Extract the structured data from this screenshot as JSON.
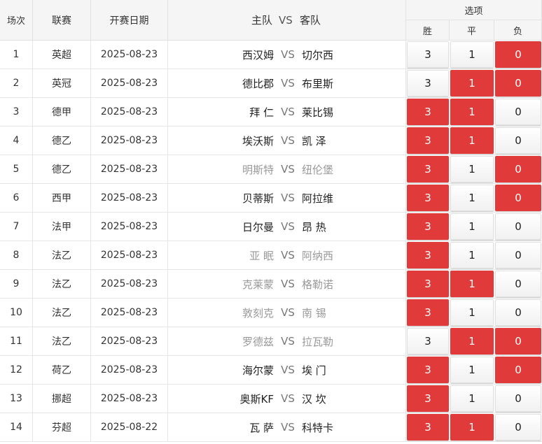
{
  "header": {
    "col_no": "场次",
    "col_league": "联赛",
    "col_date": "开赛日期",
    "home_label": "主队",
    "vs_label": "VS",
    "away_label": "客队",
    "options_label": "选项",
    "opt_win": "胜",
    "opt_draw": "平",
    "opt_loss": "负"
  },
  "colors": {
    "selected": "#e03a3a",
    "grid": "#e6e6e6",
    "header_bg": "#f5f5f5"
  },
  "rows": [
    {
      "no": "1",
      "league": "英超",
      "date": "2025-08-23",
      "home": "西汉姆",
      "vs": "VS",
      "away": "切尔西",
      "home_muted": false,
      "away_muted": false,
      "win": "3",
      "draw": "1",
      "loss": "0",
      "sel": [
        false,
        false,
        true
      ]
    },
    {
      "no": "2",
      "league": "英冠",
      "date": "2025-08-23",
      "home": "德比郡",
      "vs": "VS",
      "away": "布里斯",
      "home_muted": false,
      "away_muted": false,
      "win": "3",
      "draw": "1",
      "loss": "0",
      "sel": [
        false,
        true,
        true
      ]
    },
    {
      "no": "3",
      "league": "德甲",
      "date": "2025-08-23",
      "home": "拜 仁",
      "vs": "VS",
      "away": "莱比锡",
      "home_muted": false,
      "away_muted": false,
      "win": "3",
      "draw": "1",
      "loss": "0",
      "sel": [
        true,
        true,
        false
      ]
    },
    {
      "no": "4",
      "league": "德乙",
      "date": "2025-08-23",
      "home": "埃沃斯",
      "vs": "VS",
      "away": "凯 泽",
      "home_muted": false,
      "away_muted": false,
      "win": "3",
      "draw": "1",
      "loss": "0",
      "sel": [
        true,
        true,
        false
      ]
    },
    {
      "no": "5",
      "league": "德乙",
      "date": "2025-08-23",
      "home": "明斯特",
      "vs": "VS",
      "away": "纽伦堡",
      "home_muted": true,
      "away_muted": true,
      "win": "3",
      "draw": "1",
      "loss": "0",
      "sel": [
        true,
        false,
        true
      ]
    },
    {
      "no": "6",
      "league": "西甲",
      "date": "2025-08-23",
      "home": "贝蒂斯",
      "vs": "VS",
      "away": "阿拉维",
      "home_muted": false,
      "away_muted": false,
      "win": "3",
      "draw": "1",
      "loss": "0",
      "sel": [
        true,
        false,
        true
      ]
    },
    {
      "no": "7",
      "league": "法甲",
      "date": "2025-08-23",
      "home": "日尔曼",
      "vs": "VS",
      "away": "昂 热",
      "home_muted": false,
      "away_muted": false,
      "win": "3",
      "draw": "1",
      "loss": "0",
      "sel": [
        true,
        false,
        false
      ]
    },
    {
      "no": "8",
      "league": "法乙",
      "date": "2025-08-23",
      "home": "亚 眠",
      "vs": "VS",
      "away": "阿纳西",
      "home_muted": true,
      "away_muted": true,
      "win": "3",
      "draw": "1",
      "loss": "0",
      "sel": [
        true,
        false,
        false
      ]
    },
    {
      "no": "9",
      "league": "法乙",
      "date": "2025-08-23",
      "home": "克莱蒙",
      "vs": "VS",
      "away": "格勒诺",
      "home_muted": true,
      "away_muted": true,
      "win": "3",
      "draw": "1",
      "loss": "0",
      "sel": [
        true,
        true,
        false
      ]
    },
    {
      "no": "10",
      "league": "法乙",
      "date": "2025-08-23",
      "home": "敦刻克",
      "vs": "VS",
      "away": "南 锡",
      "home_muted": true,
      "away_muted": true,
      "win": "3",
      "draw": "1",
      "loss": "0",
      "sel": [
        true,
        false,
        false
      ]
    },
    {
      "no": "11",
      "league": "法乙",
      "date": "2025-08-23",
      "home": "罗德兹",
      "vs": "VS",
      "away": "拉瓦勒",
      "home_muted": true,
      "away_muted": true,
      "win": "3",
      "draw": "1",
      "loss": "0",
      "sel": [
        false,
        true,
        true
      ]
    },
    {
      "no": "12",
      "league": "荷乙",
      "date": "2025-08-23",
      "home": "海尔蒙",
      "vs": "VS",
      "away": "埃 门",
      "home_muted": false,
      "away_muted": false,
      "win": "3",
      "draw": "1",
      "loss": "0",
      "sel": [
        true,
        false,
        true
      ]
    },
    {
      "no": "13",
      "league": "挪超",
      "date": "2025-08-23",
      "home": "奥斯KF",
      "vs": "VS",
      "away": "汉 坎",
      "home_muted": false,
      "away_muted": false,
      "win": "3",
      "draw": "1",
      "loss": "0",
      "sel": [
        true,
        false,
        false
      ]
    },
    {
      "no": "14",
      "league": "芬超",
      "date": "2025-08-22",
      "home": "瓦 萨",
      "vs": "VS",
      "away": "科特卡",
      "home_muted": false,
      "away_muted": false,
      "win": "3",
      "draw": "1",
      "loss": "0",
      "sel": [
        true,
        true,
        false
      ]
    }
  ]
}
